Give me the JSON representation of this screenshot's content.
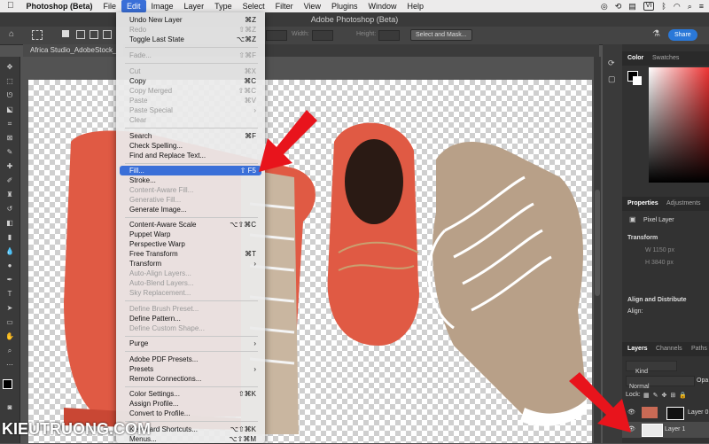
{
  "menubar": {
    "apple": "",
    "app_name": "Photoshop (Beta)",
    "items": [
      "File",
      "Edit",
      "Image",
      "Layer",
      "Type",
      "Select",
      "Filter",
      "View",
      "Plugins",
      "Window",
      "Help"
    ],
    "active": "Edit",
    "status_badge": "VI"
  },
  "window_title": "Adobe Photoshop (Beta)",
  "options": {
    "width_label": "Width:",
    "height_label": "Height:",
    "select_mask": "Select and Mask...",
    "share": "Share"
  },
  "document_tab": "Africa Studio_AdobeStock_",
  "edit_menu": {
    "rows": [
      {
        "label": "Undo New Layer",
        "shortcut": "⌘Z",
        "disabled": false
      },
      {
        "label": "Redo",
        "shortcut": "⇧⌘Z",
        "disabled": true
      },
      {
        "label": "Toggle Last State",
        "shortcut": "⌥⌘Z",
        "disabled": false
      },
      {
        "label": "Fade...",
        "shortcut": "⇧⌘F",
        "disabled": true
      },
      {
        "label": "Cut",
        "shortcut": "⌘X",
        "disabled": true
      },
      {
        "label": "Copy",
        "shortcut": "⌘C",
        "disabled": false
      },
      {
        "label": "Copy Merged",
        "shortcut": "⇧⌘C",
        "disabled": true
      },
      {
        "label": "Paste",
        "shortcut": "⌘V",
        "disabled": true
      },
      {
        "label": "Paste Special",
        "shortcut": "›",
        "disabled": true
      },
      {
        "label": "Clear",
        "shortcut": "",
        "disabled": true
      },
      {
        "label": "Search",
        "shortcut": "⌘F",
        "disabled": false
      },
      {
        "label": "Check Spelling...",
        "shortcut": "",
        "disabled": false
      },
      {
        "label": "Find and Replace Text...",
        "shortcut": "",
        "disabled": false
      },
      {
        "label": "Fill...",
        "shortcut": "⇧ F5",
        "disabled": false,
        "highlight": true
      },
      {
        "label": "Stroke...",
        "shortcut": "",
        "disabled": false
      },
      {
        "label": "Content-Aware Fill...",
        "shortcut": "",
        "disabled": true
      },
      {
        "label": "Generative Fill...",
        "shortcut": "",
        "disabled": true
      },
      {
        "label": "Generate Image...",
        "shortcut": "",
        "disabled": false
      },
      {
        "label": "Content-Aware Scale",
        "shortcut": "⌥⇧⌘C",
        "disabled": false
      },
      {
        "label": "Puppet Warp",
        "shortcut": "",
        "disabled": false
      },
      {
        "label": "Perspective Warp",
        "shortcut": "",
        "disabled": false
      },
      {
        "label": "Free Transform",
        "shortcut": "⌘T",
        "disabled": false
      },
      {
        "label": "Transform",
        "shortcut": "›",
        "disabled": false
      },
      {
        "label": "Auto-Align Layers...",
        "shortcut": "",
        "disabled": true
      },
      {
        "label": "Auto-Blend Layers...",
        "shortcut": "",
        "disabled": true
      },
      {
        "label": "Sky Replacement...",
        "shortcut": "",
        "disabled": true
      },
      {
        "label": "Define Brush Preset...",
        "shortcut": "",
        "disabled": true
      },
      {
        "label": "Define Pattern...",
        "shortcut": "",
        "disabled": false
      },
      {
        "label": "Define Custom Shape...",
        "shortcut": "",
        "disabled": true
      },
      {
        "label": "Purge",
        "shortcut": "›",
        "disabled": false
      },
      {
        "label": "Adobe PDF Presets...",
        "shortcut": "",
        "disabled": false
      },
      {
        "label": "Presets",
        "shortcut": "›",
        "disabled": false
      },
      {
        "label": "Remote Connections...",
        "shortcut": "",
        "disabled": false
      },
      {
        "label": "Color Settings...",
        "shortcut": "⇧⌘K",
        "disabled": false
      },
      {
        "label": "Assign Profile...",
        "shortcut": "",
        "disabled": false
      },
      {
        "label": "Convert to Profile...",
        "shortcut": "",
        "disabled": false
      },
      {
        "label": "Keyboard Shortcuts...",
        "shortcut": "⌥⇧⌘K",
        "disabled": false
      },
      {
        "label": "Menus...",
        "shortcut": "⌥⇧⌘M",
        "disabled": false
      }
    ]
  },
  "panels": {
    "color_tabs": [
      "Color",
      "Swatches"
    ],
    "props_tabs": [
      "Properties",
      "Adjustments"
    ],
    "pixel_layer": "Pixel Layer",
    "transform": "Transform",
    "w_value": "W  1150 px",
    "h_value": "H  3840 px",
    "align": "Align and Distribute",
    "align_sub": "Align:",
    "layers_tabs": [
      "Layers",
      "Channels",
      "Paths"
    ],
    "kind": "Kind",
    "blend": "Normal",
    "opacity": "Opa",
    "lock": "Lock:",
    "layers": [
      {
        "name": "Layer 0"
      },
      {
        "name": "Layer 1",
        "selected": true
      }
    ]
  },
  "colors": {
    "accent": "#3a6fd8",
    "arrow": "#e8141c"
  },
  "watermark": "KIEUTRUONG.COM"
}
